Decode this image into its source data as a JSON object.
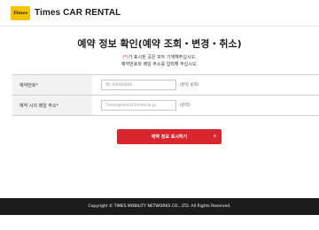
{
  "header": {
    "logo_badge": "Times",
    "brand": "Times CAR RENTAL"
  },
  "title": "예약 정보 확인(예약 조회・변경・취소)",
  "notes": {
    "required_mark": "(*)",
    "line1_rest": "가 표시된 곳은 모두 기재해주십시오.",
    "line2": "예약번호와 메일 주소를 입력해 주십시오."
  },
  "form": {
    "rows": [
      {
        "label": "예약번호*",
        "placeholder": "예) 00000000",
        "hint": "(반각 숫자)"
      },
      {
        "label": "예약 시의 메일 주소*",
        "placeholder": "Times@rental.timescar.jp",
        "hint": "(반각)"
      }
    ]
  },
  "submit": {
    "label": "예약 정보 표시하기",
    "icon": "chevron-right-icon"
  },
  "footer": {
    "copyright": "Copyright © TIMES MOBILITY NETWORKS CO., LTD. All Rights Reserved."
  },
  "colors": {
    "accent": "#d8252e",
    "logo": "#f5c400",
    "footer_bg": "#1c1c1c"
  }
}
